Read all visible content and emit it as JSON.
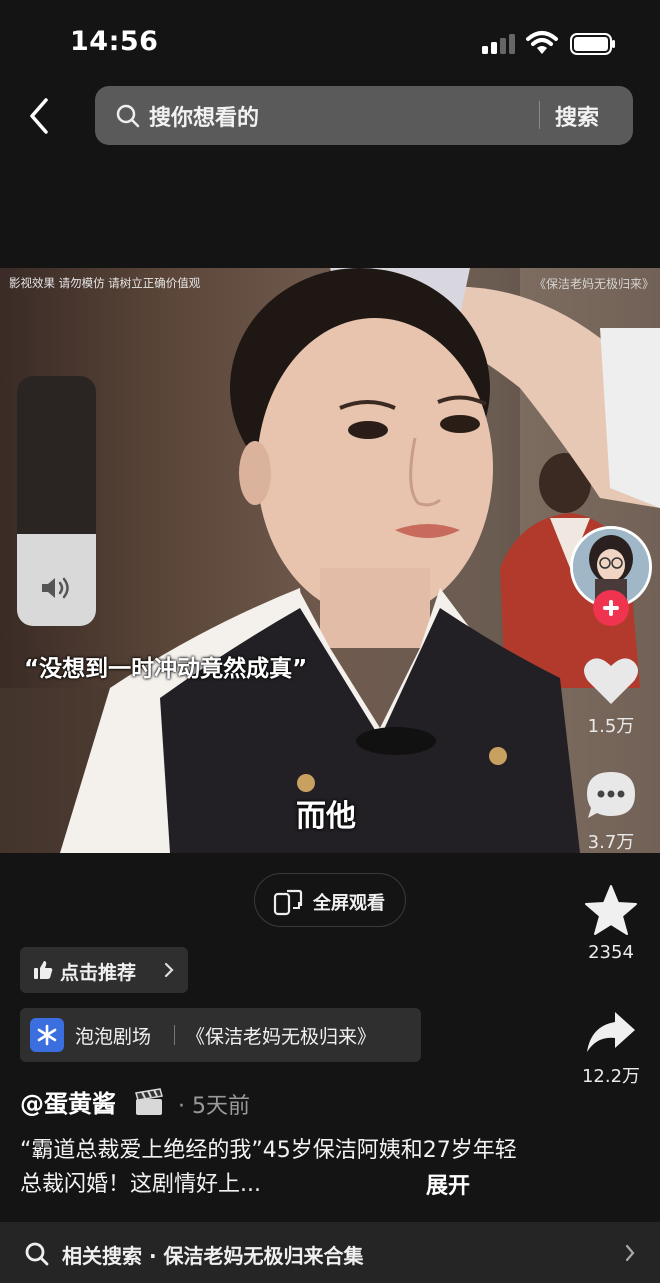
{
  "status_bar": {
    "time": "14:56"
  },
  "search": {
    "placeholder": "搜你想看的",
    "button": "搜索"
  },
  "video": {
    "disclaimer": "影视效果  请勿模仿  请树立正确价值观",
    "watermark": "《保洁老妈无极归来》",
    "quote_caption": "“没想到一时冲动竟然成真”",
    "subtitle": "而他",
    "volume_level": 0.37
  },
  "actions": {
    "likes": "1.5万",
    "comments": "3.7万",
    "favorites": "2354",
    "shares": "12.2万"
  },
  "fullscreen": {
    "label": "全屏观看"
  },
  "recommend": {
    "label": "点击推荐"
  },
  "drama": {
    "source": "泡泡剧场",
    "title": "《保洁老妈无极归来》"
  },
  "post": {
    "author": "@蛋黄酱",
    "time": "· 5天前",
    "description": "“霸道总裁爱上绝经的我”45岁保洁阿姨和27岁年轻总裁闪婚！这剧情好上...",
    "expand": "展开"
  },
  "related": {
    "text": "相关搜索 · 保洁老妈无极归来合集"
  },
  "colors": {
    "background": "#141414",
    "follow_red": "#f0334f",
    "search_bg": "#5a5a5a",
    "accent_blue": "#3b6fe0"
  }
}
